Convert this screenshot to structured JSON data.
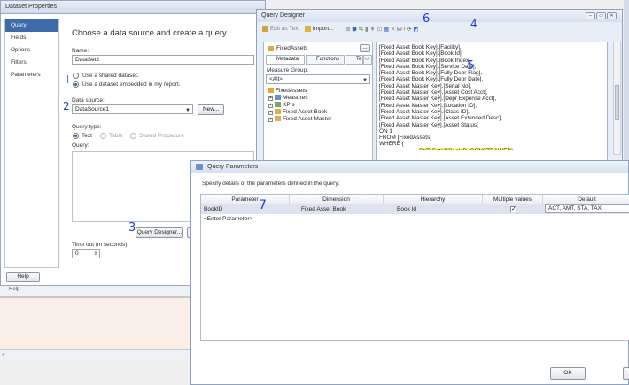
{
  "colors": {
    "accent": "#3d6aa8",
    "annotation": "#1f3bd6",
    "highlight": "#ffff5e"
  },
  "dataset_properties": {
    "title": "Dataset Properties",
    "nav": [
      "Query",
      "Fields",
      "Options",
      "Filters",
      "Parameters"
    ],
    "selected_nav": "Query",
    "heading": "Choose a data source and create a query.",
    "name_label": "Name:",
    "name_value": "DataSet2",
    "radio_shared": "Use a shared dataset.",
    "radio_embedded": "Use a dataset embedded in my report.",
    "data_source_label": "Data source:",
    "data_source_value": "DataSource1",
    "new_button": "New...",
    "query_type_label": "Query type:",
    "query_type_text": "Text",
    "query_type_table": "Table",
    "query_type_stored": "Stored Procedure",
    "query_label": "Query:",
    "query_designer_button": "Query Designer...",
    "timeout_label": "Time out (in seconds):",
    "timeout_value": "0",
    "help_button": "Help"
  },
  "background": {
    "help_text": "Help"
  },
  "annotations": {
    "a2": "2",
    "a3": "3",
    "a4": "4",
    "a5": "5",
    "a6": "6",
    "a7": "7"
  },
  "query_designer": {
    "title": "Query Designer",
    "edit_as_text": "Edit as Text",
    "import": "Import...",
    "cube": "FixedAssets",
    "cube_button": "...",
    "tabs": [
      "Metadata",
      "Functions",
      "Te"
    ],
    "measure_group_label": "Measure Group:",
    "measure_group_value": "<All>",
    "tree": [
      "FixedAssets",
      "Measures",
      "KPIs",
      "Fixed Asset Book",
      "Fixed Asset Master"
    ],
    "mdx_lines": [
      "[Fixed Asset Book Key].[Facility],",
      "[Fixed Asset Book Key].[Book Id],",
      "[Fixed Asset Book Key].[Book Index],",
      "[Fixed Asset Book Key].[Service Date],",
      "[Fixed Asset Book Key].[Fully Depr Flag],",
      "[Fixed Asset Book Key].[Fully Depr Date],",
      "[Fixed Asset Master Key].[Serial No],",
      "[Fixed Asset Master Key].[Asset Cost Acct],",
      "[Fixed Asset Master Key].[Depr Expense Acct],",
      "[Fixed Asset Master Key].[Location ID],",
      "[Fixed Asset Master Key].[Class ID],",
      "[Fixed Asset Master Key].[Asset Extended Desc],",
      "[Fixed Asset Master Key].[Asset Status]",
      "ON 1",
      "FROM [FixedAssets]",
      "WHERE  {"
    ],
    "mdx_highlight": "StrToSet(@BookID, CONSTRAINED)",
    "mdx_close": "}"
  },
  "query_parameters": {
    "title": "Query Parameters",
    "description": "Specify details of the parameters defined in the query:",
    "columns": [
      "Parameter",
      "Dimension",
      "Hierarchy",
      "Multiple values",
      "Default"
    ],
    "rows": [
      {
        "parameter": "BookID",
        "dimension": "Fixed Asset Book",
        "hierarchy": "Book Id",
        "multiple_values": true,
        "default": "ACT, AMT, STA, TAX"
      }
    ],
    "enter_parameter": "<Enter Parameter>",
    "ok_button": "OK"
  }
}
